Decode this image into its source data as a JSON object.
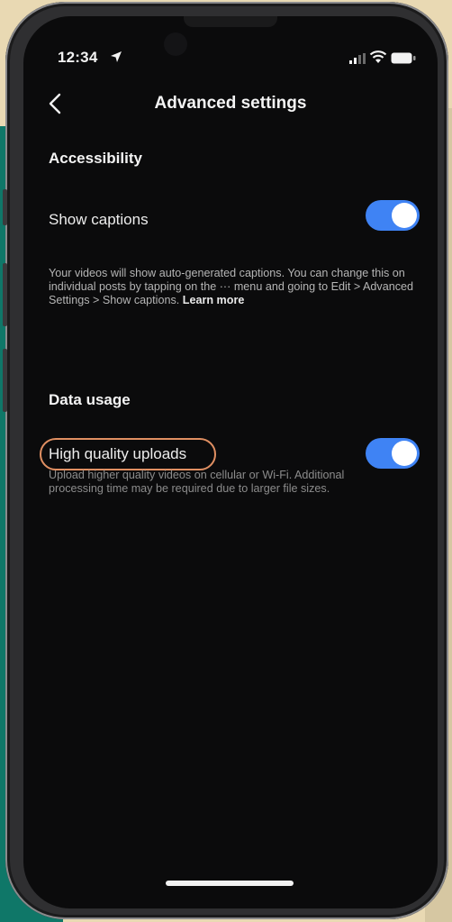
{
  "status_bar": {
    "time": "12:34"
  },
  "nav": {
    "title": "Advanced settings"
  },
  "accessibility": {
    "header": "Accessibility",
    "show_captions": {
      "label": "Show captions",
      "enabled": true,
      "description": "Your videos will show auto-generated captions. You can change this on individual posts by tapping on the ··· menu and going to Edit > Advanced Settings > Show captions.",
      "learn_more": "Learn more"
    }
  },
  "data_usage": {
    "header": "Data usage",
    "high_quality_uploads": {
      "label": "High quality uploads",
      "enabled": true,
      "description": "Upload higher quality videos on cellular or Wi-Fi. Additional processing time may be required due to larger file sizes."
    }
  },
  "colors": {
    "toggle_on": "#3f83f4",
    "screen_background": "#0b0b0c",
    "highlight_ring": "#e08f62",
    "backdrop_teal": "#0f7768",
    "backdrop_cream": "#e9d9b3"
  }
}
